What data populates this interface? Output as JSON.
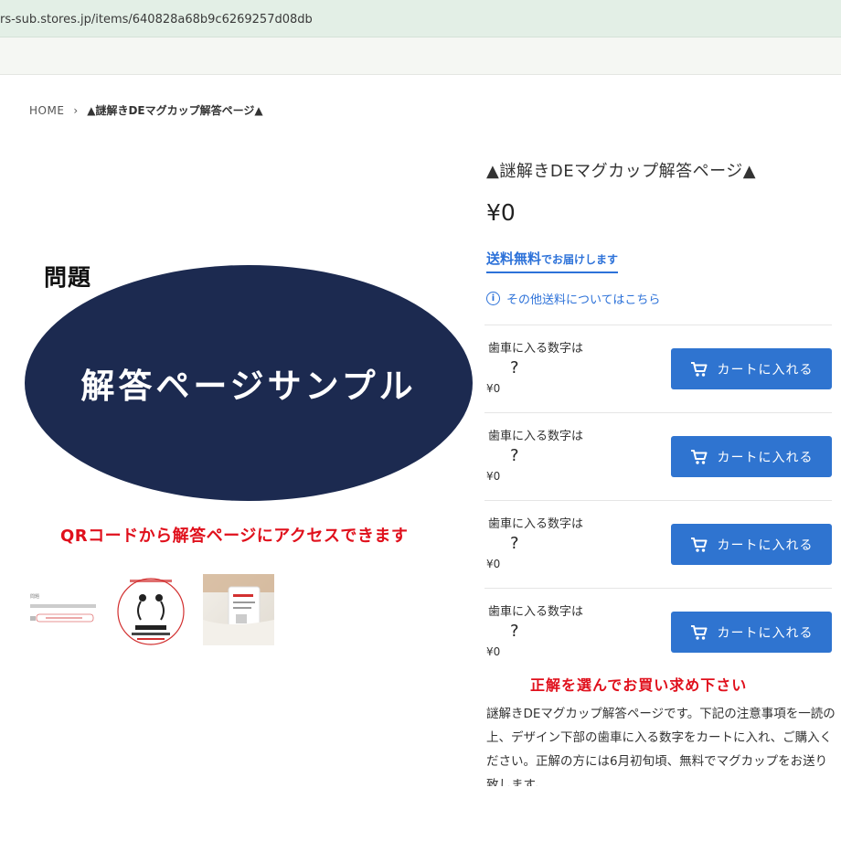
{
  "browser": {
    "url": "rs-sub.stores.jp/items/640828a68b9c6269257d08db"
  },
  "breadcrumb": {
    "home": "HOME",
    "separator": "›",
    "current": "▲謎解きDEマグカップ解答ページ▲"
  },
  "gallery": {
    "mondai_label": "問題",
    "main_text": "解答ページサンプル",
    "qr_note": "QRコードから解答ページにアクセスできます",
    "oval_color": "#1c2a50",
    "note_color": "#e0101c"
  },
  "product": {
    "title": "▲謎解きDEマグカップ解答ページ▲",
    "price": "¥0",
    "shipping_free": "送料無料",
    "shipping_rest": "でお届けします",
    "other_shipping": "その他送料についてはこちら",
    "accent_color": "#2d72d9"
  },
  "variants": [
    {
      "label": "歯車に入る数字は",
      "value": "?",
      "price": "¥0",
      "button": "カートに入れる"
    },
    {
      "label": "歯車に入る数字は",
      "value": "?",
      "price": "¥0",
      "button": "カートに入れる"
    },
    {
      "label": "歯車に入る数字は",
      "value": "?",
      "price": "¥0",
      "button": "カートに入れる"
    },
    {
      "label": "歯車に入る数字は",
      "value": "?",
      "price": "¥0",
      "button": "カートに入れる"
    }
  ],
  "select_note": "正解を選んでお買い求め下さい",
  "description": "謎解きDEマグカップ解答ページです。下記の注意事項を一読の上、デザイン下部の歯車に入る数字をカートに入れ、ご購入ください。正解の方には6月初旬頃、無料でマグカップをお送り致します。"
}
